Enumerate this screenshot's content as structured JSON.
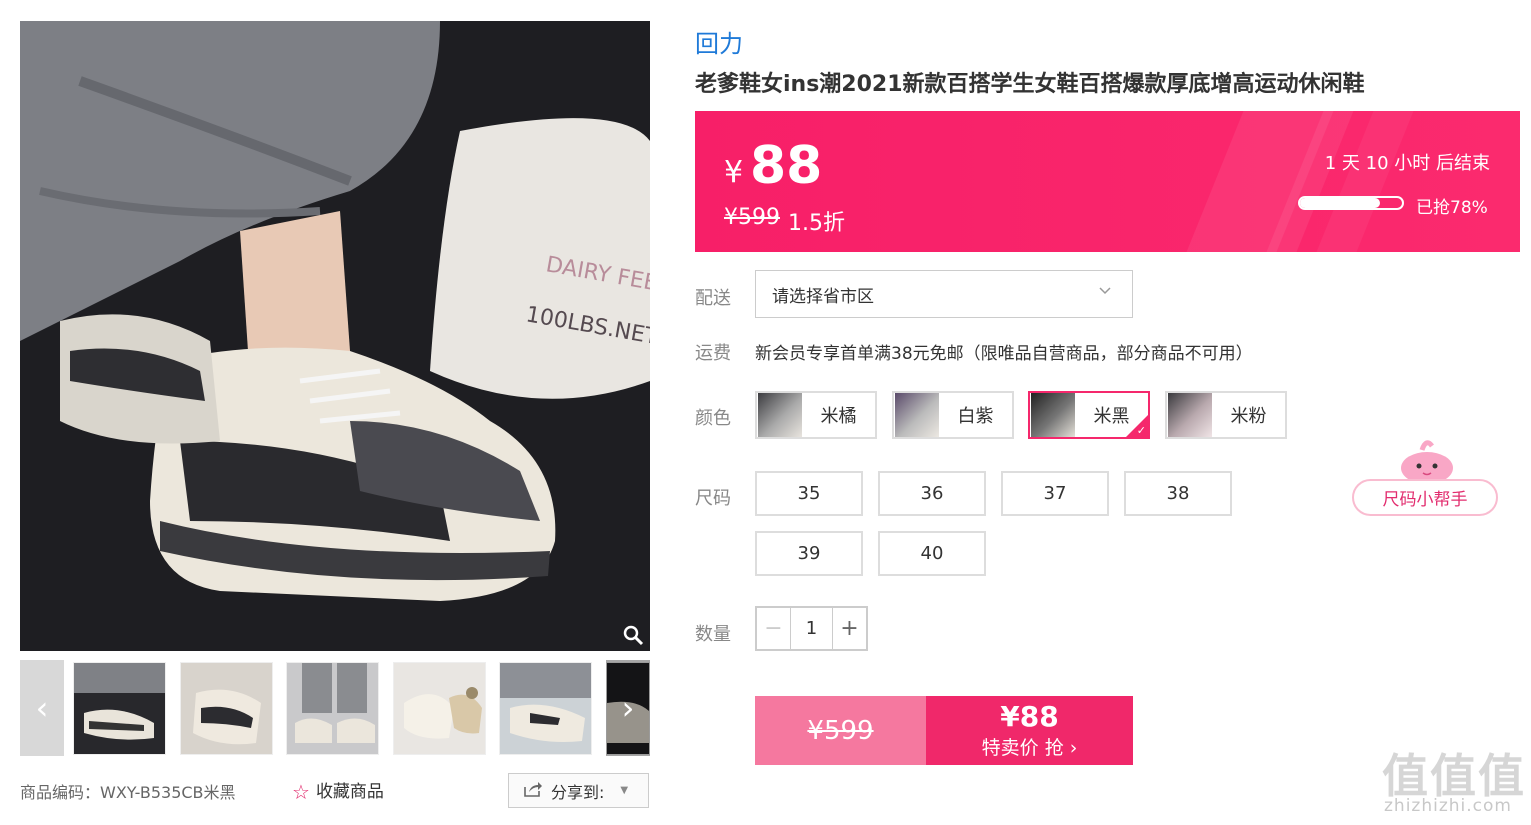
{
  "gallery": {
    "main_alt": "sneaker-photo",
    "thumbnails": [
      "thumb-1",
      "thumb-2",
      "thumb-3",
      "thumb-4",
      "thumb-5",
      "thumb-6"
    ],
    "prev_icon": "chevron-left-icon",
    "next_icon": "chevron-right-icon",
    "zoom_icon": "magnifier-icon"
  },
  "meta": {
    "sku": "商品编码：WXY-B535CB米黑",
    "favorite_label": "收藏商品",
    "share_label": "分享到:"
  },
  "product": {
    "brand": "回力",
    "title": "老爹鞋女ins潮2021新款百搭学生女鞋百搭爆款厚底增高运动休闲鞋"
  },
  "price": {
    "currency": "¥",
    "current": "88",
    "original": "¥599",
    "discount": "1.5折",
    "countdown": "1  天 10 小时 后结束",
    "sold_label": "已抢78%",
    "sold_fraction": 0.78,
    "accent": "#fb2a6e"
  },
  "delivery": {
    "label": "配送",
    "placeholder": "请选择省市区"
  },
  "freight": {
    "label": "运费",
    "text": "新会员专享首单满38元免邮（限唯品自营商品，部分商品不可用）"
  },
  "colors": {
    "label": "颜色",
    "options": [
      "米橘",
      "白紫",
      "米黑",
      "米粉"
    ],
    "selected": "米黑"
  },
  "sizes": {
    "label": "尺码",
    "options": [
      "35",
      "36",
      "37",
      "38",
      "39",
      "40"
    ],
    "helper": "尺码小帮手"
  },
  "quantity": {
    "label": "数量",
    "value": "1",
    "minus": "−",
    "plus": "+"
  },
  "buy": {
    "original": "¥599",
    "price": "¥88",
    "action": "特卖价 抢 ›"
  },
  "watermark": {
    "main": "值值值",
    "sub": "zhizhizhi.com"
  }
}
